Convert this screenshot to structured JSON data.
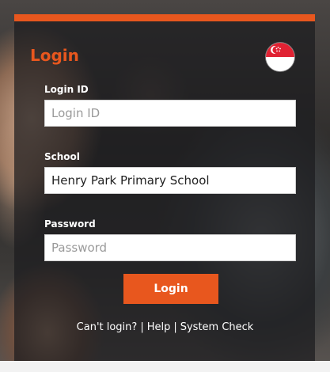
{
  "header": {
    "title": "Login"
  },
  "form": {
    "login_id": {
      "label": "Login ID",
      "value": "",
      "placeholder": "Login ID"
    },
    "school": {
      "label": "School",
      "value": "Henry Park Primary School"
    },
    "password": {
      "label": "Password",
      "value": "",
      "placeholder": "Password"
    },
    "submit_label": "Login"
  },
  "links": {
    "cant_login": "Can't login?",
    "separator": "|",
    "help": "Help",
    "system_check": "System Check"
  },
  "icons": {
    "language_flag": "singapore-flag-icon"
  },
  "colors": {
    "accent": "#e8571e",
    "panel": "#1c1c1e",
    "text": "#ffffff"
  }
}
